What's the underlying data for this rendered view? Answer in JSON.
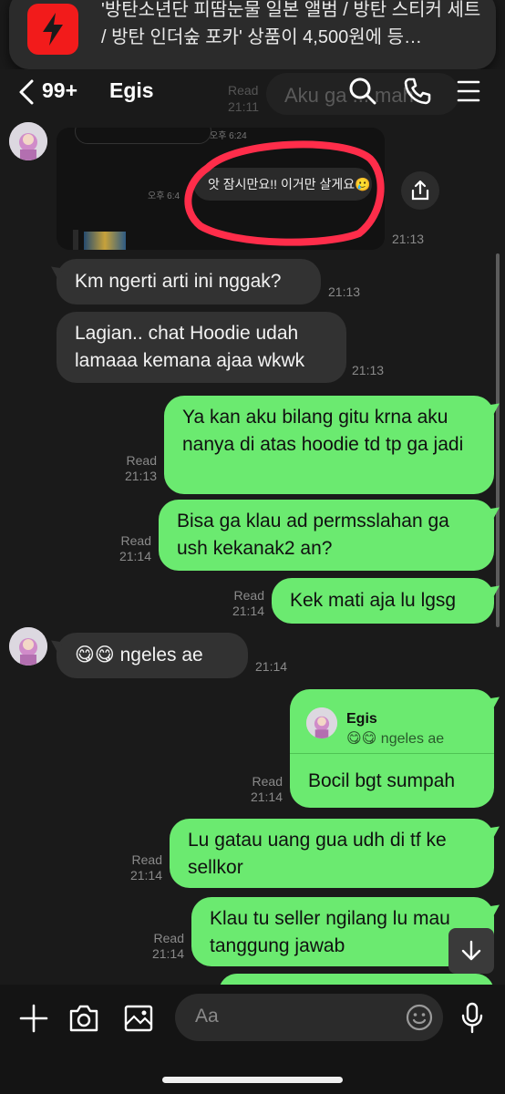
{
  "notification": {
    "text": "'방탄소년단 피땀눈물 일본 앨범 / 방탄 스티커 세트 / 방탄 인더숲 포카' 상품이 4,500원에 등…"
  },
  "header": {
    "unread_count": "99+",
    "chat_name": "Egis",
    "background_preview": "Aku ga ... mah",
    "background_read": "Read",
    "background_time": "21:11"
  },
  "image_message": {
    "time_top": "오후 6:24",
    "time_mid": "오후 6:4",
    "highlighted_text": "앗 잠시만요!! 이거만 살게요🥲",
    "sent_time": "21:13"
  },
  "messages": [
    {
      "text": "Km ngerti arti ini nggak?",
      "time": "21:13"
    },
    {
      "text": "Lagian.. chat Hoodie udah lamaaa kemana ajaa wkwk",
      "time": "21:13"
    },
    {
      "text": "Ya kan aku bilang gitu krna aku nanya di atas hoodie td tp ga jadi",
      "read": "Read",
      "time": "21:13"
    },
    {
      "text": "Bisa ga klau ad permsslahan ga ush kekanak2 an?",
      "read": "Read",
      "time": "21:14"
    },
    {
      "text": "Kek mati aja lu lgsg",
      "read": "Read",
      "time": "21:14"
    },
    {
      "text": "😋😋 ngeles ae",
      "time": "21:14"
    },
    {
      "reply_name": "Egis",
      "reply_quote": "😋😋 ngeles ae",
      "text": "Bocil bgt sumpah",
      "read": "Read",
      "time": "21:14"
    },
    {
      "text": "Lu gatau uang gua udh di tf ke sellkor",
      "read": "Read",
      "time": "21:14"
    },
    {
      "text": "Klau tu seller ngilang lu mau tanggung jawab",
      "read": "Read",
      "time": "21:14"
    }
  ],
  "input": {
    "placeholder": "Aa"
  },
  "icons": {
    "back": "chevron-left-icon",
    "search": "search-icon",
    "call": "phone-icon",
    "menu": "menu-icon",
    "share": "share-icon",
    "add": "plus-icon",
    "camera": "camera-icon",
    "gallery": "image-icon",
    "emoji": "emoji-icon",
    "mic": "microphone-icon",
    "scroll_down": "arrow-down-icon"
  },
  "colors": {
    "background": "#1a1a1a",
    "outgoing_bubble": "#6bea70",
    "incoming_bubble": "#323232",
    "highlight_circle": "#ff2d4a",
    "notification_icon": "#f21b1b"
  }
}
